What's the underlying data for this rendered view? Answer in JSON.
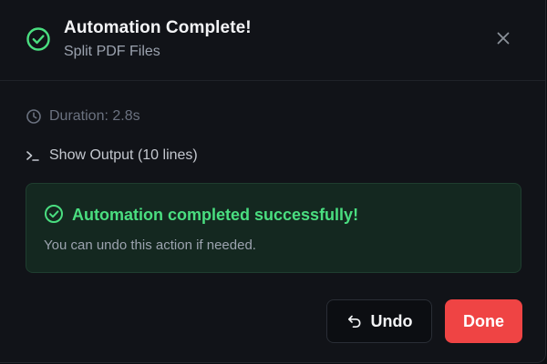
{
  "dialog": {
    "title": "Automation Complete!",
    "subtitle": "Split PDF Files",
    "close_icon": "close-icon",
    "status_icon": "check-circle-icon"
  },
  "details": {
    "duration_icon": "clock-icon",
    "duration_text": "Duration: 2.8s",
    "output_icon": "terminal-icon",
    "output_toggle_label": "Show Output (10 lines)"
  },
  "success_alert": {
    "icon": "check-circle-icon",
    "title": "Automation completed successfully!",
    "message": "You can undo this action if needed."
  },
  "actions": {
    "undo_icon": "undo-arrow-icon",
    "undo_label": "Undo",
    "done_label": "Done"
  },
  "colors": {
    "success": "#4ade80",
    "danger": "#ef4444",
    "background": "#111318"
  }
}
